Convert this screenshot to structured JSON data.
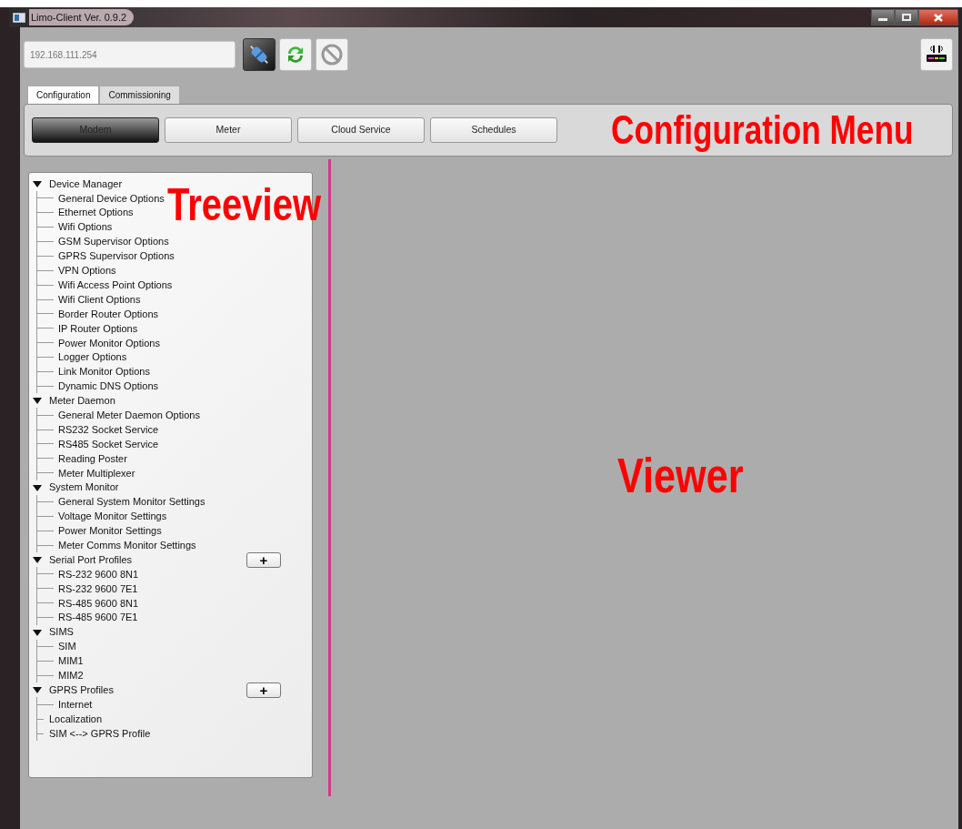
{
  "window": {
    "title": "Limo-Client Ver. 0.9.2",
    "controls": [
      {
        "kind": "minimize"
      },
      {
        "kind": "maximize"
      },
      {
        "kind": "close"
      }
    ]
  },
  "toolbar": {
    "address": "192.168.111.254",
    "buttons": [
      {
        "kind": "connect",
        "pressed": true
      },
      {
        "kind": "refresh",
        "pressed": false
      },
      {
        "kind": "stop",
        "pressed": false
      }
    ],
    "right_button": {
      "kind": "router"
    }
  },
  "tabs": [
    {
      "label": "Configuration",
      "selected": true
    },
    {
      "label": "Commissioning",
      "selected": false
    }
  ],
  "menu_buttons": [
    {
      "label": "Modem",
      "selected": true
    },
    {
      "label": "Meter",
      "selected": false
    },
    {
      "label": "Cloud Service",
      "selected": false
    },
    {
      "label": "Schedules",
      "selected": false
    }
  ],
  "annotations": {
    "menu": "Configuration Menu",
    "tree": "Treeview",
    "viewer": "Viewer"
  },
  "tree": [
    {
      "label": "Device Manager",
      "expanded": true,
      "children": [
        {
          "label": "General Device Options"
        },
        {
          "label": "Ethernet Options"
        },
        {
          "label": "Wifi Options"
        },
        {
          "label": "GSM Supervisor Options"
        },
        {
          "label": "GPRS Supervisor Options"
        },
        {
          "label": "VPN Options"
        },
        {
          "label": "Wifi Access Point Options"
        },
        {
          "label": "Wifi Client Options"
        },
        {
          "label": "Border Router Options"
        },
        {
          "label": "IP Router Options"
        },
        {
          "label": "Power Monitor Options"
        },
        {
          "label": "Logger Options"
        },
        {
          "label": "Link Monitor Options"
        },
        {
          "label": "Dynamic DNS Options"
        }
      ]
    },
    {
      "label": "Meter Daemon",
      "expanded": true,
      "children": [
        {
          "label": "General Meter Daemon Options"
        },
        {
          "label": "RS232 Socket Service"
        },
        {
          "label": "RS485 Socket Service"
        },
        {
          "label": "Reading Poster"
        },
        {
          "label": "Meter Multiplexer"
        }
      ]
    },
    {
      "label": "System Monitor",
      "expanded": true,
      "children": [
        {
          "label": "General System Monitor Settings"
        },
        {
          "label": "Voltage Monitor Settings"
        },
        {
          "label": "Power Monitor Settings"
        },
        {
          "label": "Meter Comms Monitor Settings"
        }
      ]
    },
    {
      "label": "Serial Port Profiles",
      "expanded": true,
      "add_button": "+",
      "children": [
        {
          "label": "RS-232 9600 8N1"
        },
        {
          "label": "RS-232 9600 7E1"
        },
        {
          "label": "RS-485 9600 8N1"
        },
        {
          "label": "RS-485 9600 7E1"
        }
      ]
    },
    {
      "label": "SIMS",
      "expanded": true,
      "children": [
        {
          "label": "SIM"
        },
        {
          "label": "MIM1"
        },
        {
          "label": "MIM2"
        }
      ]
    },
    {
      "label": "GPRS Profiles",
      "expanded": true,
      "add_button": "+",
      "children": [
        {
          "label": "Internet"
        }
      ]
    },
    {
      "label": "Localization"
    },
    {
      "label": "SIM <--> GPRS Profile"
    }
  ]
}
